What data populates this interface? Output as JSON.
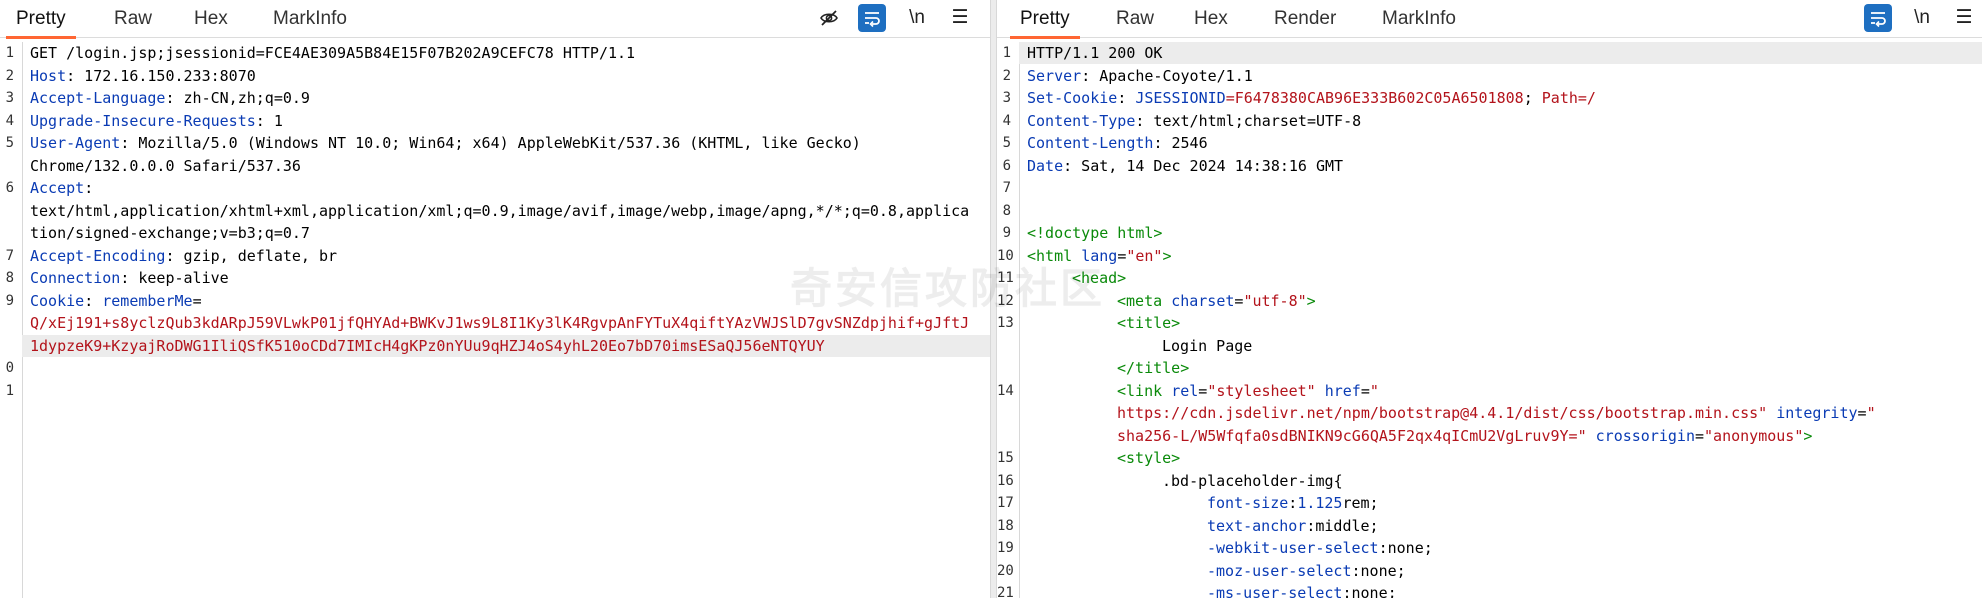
{
  "left": {
    "tabs": [
      "Pretty",
      "Raw",
      "Hex",
      "MarkInfo"
    ],
    "lines": [
      {
        "n": "1",
        "parts": [
          [
            "",
            "GET /login.jsp;jsessionid=FCE4AE309A5B84E15F07B202A9CEFC78 HTTP/1.1"
          ]
        ]
      },
      {
        "n": "2",
        "parts": [
          [
            "k",
            "Host"
          ],
          [
            "",
            ": 172.16.150.233:8070"
          ]
        ]
      },
      {
        "n": "3",
        "parts": [
          [
            "k",
            "Accept-Language"
          ],
          [
            "",
            ": zh-CN,zh;q=0.9"
          ]
        ]
      },
      {
        "n": "4",
        "parts": [
          [
            "k",
            "Upgrade-Insecure-Requests"
          ],
          [
            "",
            ": 1"
          ]
        ]
      },
      {
        "n": "5",
        "parts": [
          [
            "k",
            "User-Agent"
          ],
          [
            "",
            ": Mozilla/5.0 (Windows NT 10.0; Win64; x64) AppleWebKit/537.36 (KHTML, like Gecko)"
          ]
        ]
      },
      {
        "n": "",
        "parts": [
          [
            "",
            "Chrome/132.0.0.0 Safari/537.36"
          ]
        ]
      },
      {
        "n": "6",
        "parts": [
          [
            "k",
            "Accept"
          ],
          [
            "",
            ":"
          ]
        ]
      },
      {
        "n": "",
        "parts": [
          [
            "",
            "text/html,application/xhtml+xml,application/xml;q=0.9,image/avif,image/webp,image/apng,*/*;q=0.8,applica"
          ]
        ]
      },
      {
        "n": "",
        "parts": [
          [
            "",
            "tion/signed-exchange;v=b3;q=0.7"
          ]
        ]
      },
      {
        "n": "7",
        "parts": [
          [
            "k",
            "Accept-Encoding"
          ],
          [
            "",
            ": gzip, deflate, br"
          ]
        ]
      },
      {
        "n": "8",
        "parts": [
          [
            "k",
            "Connection"
          ],
          [
            "",
            ": keep-alive"
          ]
        ]
      },
      {
        "n": "9",
        "parts": [
          [
            "k",
            "Cookie"
          ],
          [
            "",
            ": "
          ],
          [
            "k",
            "rememberMe"
          ],
          [
            "",
            "="
          ]
        ]
      },
      {
        "n": "",
        "parts": [
          [
            "v",
            "Q/xEj191+s8yclzQub3kdARpJ59VLwkP01jfQHYAd+BWKvJ1ws9L8I1Ky3lK4RgvpAnFYTuX4qiftYAzVWJSlD7gvSNZdpjhif+gJftJ"
          ]
        ]
      },
      {
        "n": "",
        "parts": [
          [
            "v",
            "1dypzeK9+KzyajRoDWG1IliQSfK510oCDd7IMIcH4gKPz0nYUu9qHZJ4oS4yhL20Eo7bD70imsESaQJ56eNTQYUY"
          ]
        ]
      },
      {
        "n": "0",
        "parts": [
          [
            "",
            ""
          ]
        ]
      },
      {
        "n": "1",
        "parts": [
          [
            "",
            ""
          ]
        ]
      }
    ]
  },
  "right": {
    "tabs": [
      "Pretty",
      "Raw",
      "Hex",
      "Render",
      "MarkInfo"
    ],
    "lines": [
      {
        "n": "1",
        "i": 0,
        "parts": [
          [
            "",
            "HTTP/1.1 200 OK"
          ]
        ]
      },
      {
        "n": "2",
        "i": 0,
        "parts": [
          [
            "k",
            "Server"
          ],
          [
            "",
            ": Apache-Coyote/1.1"
          ]
        ]
      },
      {
        "n": "3",
        "i": 0,
        "parts": [
          [
            "k",
            "Set-Cookie"
          ],
          [
            "",
            ": "
          ],
          [
            "k",
            "JSESSIONID"
          ],
          [
            "v",
            "=F6478380CAB96E333B602C05A6501808"
          ],
          [
            "",
            ";"
          ],
          [
            "v",
            " Path=/"
          ]
        ]
      },
      {
        "n": "4",
        "i": 0,
        "parts": [
          [
            "k",
            "Content-Type"
          ],
          [
            "",
            ": text/html;charset=UTF-8"
          ]
        ]
      },
      {
        "n": "5",
        "i": 0,
        "parts": [
          [
            "k",
            "Content-Length"
          ],
          [
            "",
            ": 2546"
          ]
        ]
      },
      {
        "n": "6",
        "i": 0,
        "parts": [
          [
            "k",
            "Date"
          ],
          [
            "",
            ": Sat, 14 Dec 2024 14:38:16 GMT"
          ]
        ]
      },
      {
        "n": "7",
        "i": 0,
        "parts": [
          [
            "",
            ""
          ]
        ]
      },
      {
        "n": "8",
        "i": 0,
        "parts": [
          [
            "",
            ""
          ]
        ]
      },
      {
        "n": "9",
        "i": 0,
        "parts": [
          [
            "t",
            "<!doctype html>"
          ]
        ]
      },
      {
        "n": "10",
        "i": 0,
        "parts": [
          [
            "t",
            "<html "
          ],
          [
            "a",
            "lang"
          ],
          [
            "",
            "="
          ],
          [
            "s",
            "\"en\""
          ],
          [
            "t",
            ">"
          ]
        ]
      },
      {
        "n": "11",
        "i": 1,
        "parts": [
          [
            "t",
            "<head>"
          ]
        ]
      },
      {
        "n": "12",
        "i": 2,
        "parts": [
          [
            "t",
            "<meta "
          ],
          [
            "a",
            "charset"
          ],
          [
            "",
            "="
          ],
          [
            "s",
            "\"utf-8\""
          ],
          [
            "t",
            ">"
          ]
        ]
      },
      {
        "n": "13",
        "i": 2,
        "parts": [
          [
            "t",
            "<title>"
          ]
        ]
      },
      {
        "n": "",
        "i": 3,
        "parts": [
          [
            "",
            "Login Page"
          ]
        ]
      },
      {
        "n": "",
        "i": 2,
        "parts": [
          [
            "t",
            "</title>"
          ]
        ]
      },
      {
        "n": "14",
        "i": 2,
        "parts": [
          [
            "t",
            "<link "
          ],
          [
            "a",
            "rel"
          ],
          [
            "",
            "="
          ],
          [
            "s",
            "\"stylesheet\""
          ],
          [
            "a",
            " href"
          ],
          [
            "",
            "="
          ],
          [
            "s",
            "\""
          ]
        ]
      },
      {
        "n": "",
        "i": 2,
        "parts": [
          [
            "s",
            "https://cdn.jsdelivr.net/npm/bootstrap@4.4.1/dist/css/bootstrap.min.css\""
          ],
          [
            "a",
            " integrity"
          ],
          [
            "",
            "="
          ],
          [
            "s",
            "\""
          ]
        ]
      },
      {
        "n": "",
        "i": 2,
        "parts": [
          [
            "s",
            "sha256-L/W5Wfqfa0sdBNIKN9cG6QA5F2qx4qICmU2VgLruv9Y=\""
          ],
          [
            "a",
            " crossorigin"
          ],
          [
            "",
            "="
          ],
          [
            "s",
            "\"anonymous\""
          ],
          [
            "t",
            ">"
          ]
        ]
      },
      {
        "n": "15",
        "i": 2,
        "parts": [
          [
            "t",
            "<style>"
          ]
        ]
      },
      {
        "n": "16",
        "i": 3,
        "parts": [
          [
            "",
            "."
          ],
          [
            "",
            "bd-placeholder-img{"
          ]
        ]
      },
      {
        "n": "17",
        "i": 4,
        "parts": [
          [
            "k",
            "font-size"
          ],
          [
            "",
            ":"
          ],
          [
            "k",
            "1.125"
          ],
          [
            "",
            "rem;"
          ]
        ]
      },
      {
        "n": "18",
        "i": 4,
        "parts": [
          [
            "k",
            "text-anchor"
          ],
          [
            "",
            ":middle;"
          ]
        ]
      },
      {
        "n": "19",
        "i": 4,
        "parts": [
          [
            "k",
            "-webkit-user-select"
          ],
          [
            "",
            ":none;"
          ]
        ]
      },
      {
        "n": "20",
        "i": 4,
        "parts": [
          [
            "k",
            "-moz-user-select"
          ],
          [
            "",
            ":none;"
          ]
        ]
      },
      {
        "n": "21",
        "i": 4,
        "parts": [
          [
            "k",
            "-ms-user-select"
          ],
          [
            "",
            ":none;"
          ]
        ]
      }
    ]
  },
  "watermark": "奇安信攻防社区",
  "icons": {
    "eye_off": "eye-off-icon",
    "wrap": "wrap-icon",
    "newline": "\\n",
    "menu": "☰"
  }
}
